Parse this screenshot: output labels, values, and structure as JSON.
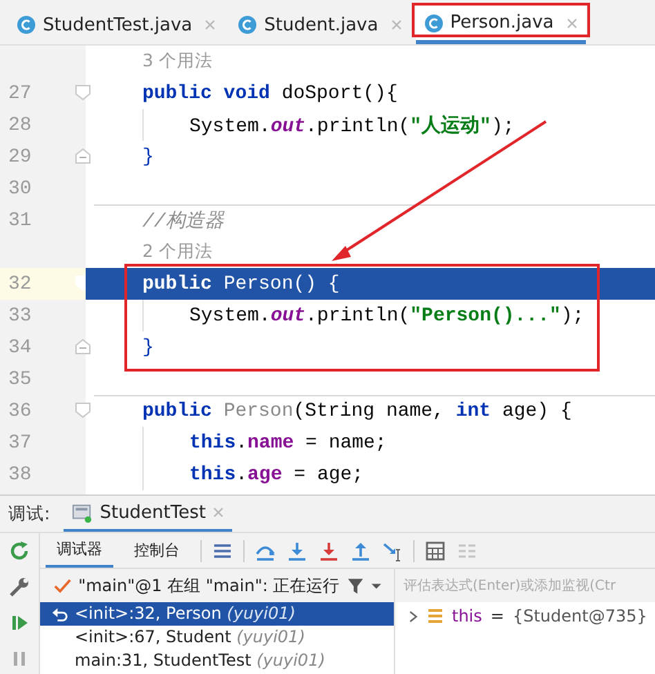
{
  "editor_tabs": [
    {
      "label": "StudentTest.java",
      "selected": false,
      "annotated": false
    },
    {
      "label": "Student.java",
      "selected": false,
      "annotated": false
    },
    {
      "label": "Person.java",
      "selected": true,
      "annotated": true
    }
  ],
  "code_lines": [
    {
      "kind": "hint",
      "text": "3 个用法"
    },
    {
      "kind": "code",
      "number": "27",
      "fold_start": true,
      "tokens": [
        {
          "kind": "keyword",
          "s": "public void "
        },
        {
          "kind": "plain",
          "s": "doSport(){"
        }
      ],
      "children": [
        {
          "kind": "code",
          "number": "28",
          "tokens": [
            {
              "kind": "plain",
              "s": "System."
            },
            {
              "kind": "static",
              "s": "out"
            },
            {
              "kind": "plain",
              "s": ".println("
            },
            {
              "kind": "string",
              "s": "\"人运动\""
            },
            {
              "kind": "plain",
              "s": ");"
            }
          ]
        }
      ]
    },
    {
      "kind": "code",
      "number": "29",
      "fold_end": true,
      "tokens": [
        {
          "kind": "brace",
          "s": "}"
        }
      ]
    },
    {
      "kind": "code",
      "number": "30"
    },
    {
      "kind": "code",
      "number": "31",
      "separator": true,
      "tokens": [
        {
          "kind": "comment",
          "s": "//构造器"
        }
      ]
    },
    {
      "kind": "hint",
      "text": "2 个用法"
    },
    {
      "kind": "code",
      "number": "32",
      "fold_start": true,
      "current": true,
      "tokens": [
        {
          "kind": "keyword",
          "s": "public "
        },
        {
          "kind": "plain",
          "s": "Person() {"
        }
      ],
      "children": [
        {
          "kind": "code",
          "number": "33",
          "tokens": [
            {
              "kind": "plain",
              "s": "System."
            },
            {
              "kind": "static",
              "s": "out"
            },
            {
              "kind": "plain",
              "s": ".println("
            },
            {
              "kind": "string",
              "s": "\"Person()...\""
            },
            {
              "kind": "plain",
              "s": ");"
            }
          ]
        }
      ]
    },
    {
      "kind": "code",
      "number": "34",
      "fold_end": true,
      "tokens": [
        {
          "kind": "brace",
          "s": "}"
        }
      ]
    },
    {
      "kind": "code",
      "number": "35"
    },
    {
      "kind": "code",
      "number": "36",
      "fold_start": true,
      "separator": true,
      "tokens": [
        {
          "kind": "keyword",
          "s": "public "
        },
        {
          "kind": "unused",
          "s": "Person"
        },
        {
          "kind": "plain",
          "s": "(String name, "
        },
        {
          "kind": "keyword",
          "s": "int "
        },
        {
          "kind": "plain",
          "s": "age) {"
        }
      ],
      "children": [
        {
          "kind": "code",
          "number": "37",
          "tokens": [
            {
              "kind": "keyword",
              "s": "this"
            },
            {
              "kind": "plain",
              "s": "."
            },
            {
              "kind": "field",
              "s": "name"
            },
            {
              "kind": "plain",
              "s": " = name;"
            }
          ]
        },
        {
          "kind": "code",
          "number": "38",
          "tokens": [
            {
              "kind": "keyword",
              "s": "this"
            },
            {
              "kind": "plain",
              "s": "."
            },
            {
              "kind": "field",
              "s": "age"
            },
            {
              "kind": "plain",
              "s": " = age;"
            }
          ]
        }
      ]
    }
  ],
  "debug": {
    "title": "调试:",
    "session_tab": "StudentTest",
    "view_tabs": [
      {
        "label": "调试器",
        "selected": true
      },
      {
        "label": "控制台",
        "selected": false
      }
    ],
    "thread": "\"main\"@1 在组 \"main\": 正在运行",
    "frames": [
      {
        "location": "<init>:32, Person",
        "package": "(yuyi01)",
        "selected": true
      },
      {
        "location": "<init>:67, Student",
        "package": "(yuyi01)",
        "selected": false
      },
      {
        "location": "main:31, StudentTest",
        "package": "(yuyi01)",
        "selected": false
      }
    ],
    "evaluate_placeholder": "评估表达式(Enter)或添加监视(Ctr",
    "variables": [
      {
        "name": "this",
        "eq": "=",
        "value": "{Student@735}"
      }
    ]
  }
}
